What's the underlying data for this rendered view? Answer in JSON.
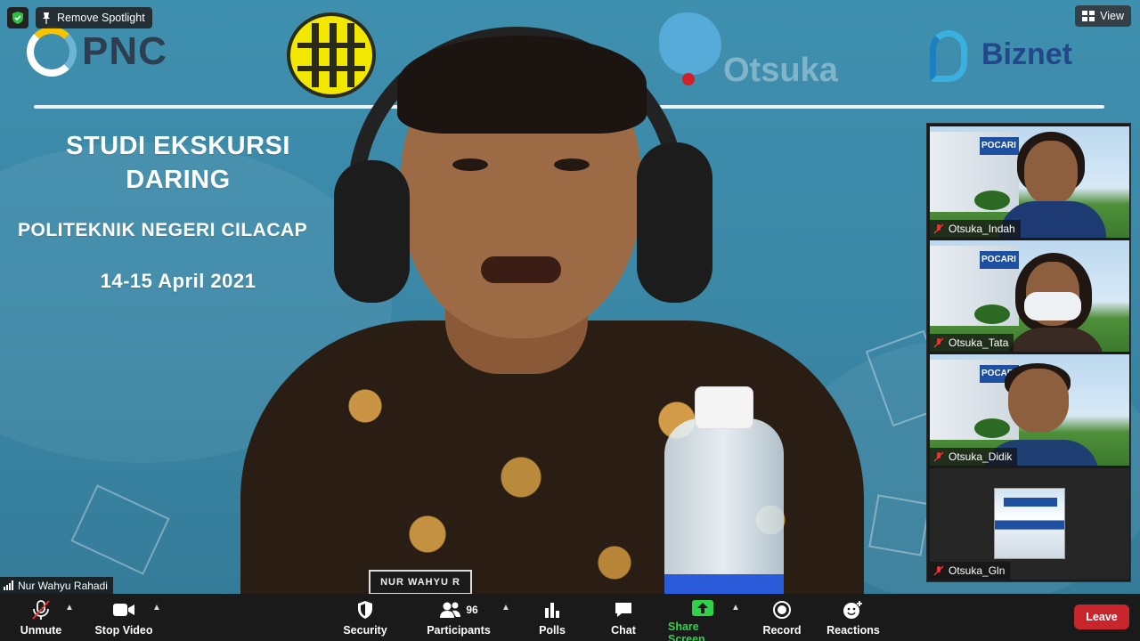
{
  "top_controls": {
    "remove_spotlight_label": "Remove Spotlight",
    "view_label": "View",
    "shield_icon": "shield-check-icon"
  },
  "main_video": {
    "speaker_name": "Nur Wahyu Rahadi",
    "nametag_text": "NUR WAHYU R",
    "slide": {
      "logo_pnc": "PNC",
      "logo_biznet": "Biznet",
      "logo_otsuka": "Otsuka",
      "title_line1": "STUDI EKSKURSI",
      "title_line2": "DARING",
      "institution": "POLITEKNIK NEGERI CILACAP",
      "date": "14-15 April 2021"
    }
  },
  "participants_panel": {
    "tiles": [
      {
        "name": "Otsuka_Indah",
        "muted": true,
        "building_text": "POCARI"
      },
      {
        "name": "Otsuka_Tata",
        "muted": true,
        "building_text": "POCARI"
      },
      {
        "name": "Otsuka_Didik",
        "muted": true,
        "building_text": "POCARI"
      },
      {
        "name": "Otsuka_Gln",
        "muted": true
      }
    ]
  },
  "toolbar": {
    "unmute": "Unmute",
    "stop_video": "Stop Video",
    "security": "Security",
    "participants": "Participants",
    "participants_count": "96",
    "polls": "Polls",
    "chat": "Chat",
    "share_screen": "Share Screen",
    "record": "Record",
    "reactions": "Reactions",
    "leave": "Leave"
  },
  "colors": {
    "toolbar_bg": "#1a1a1a",
    "leave_red": "#c9252d",
    "share_green": "#2fd34a",
    "slide_bg": "#3a86a5"
  }
}
